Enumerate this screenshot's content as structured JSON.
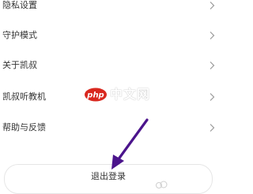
{
  "settings": {
    "items": [
      {
        "label": "隐私设置"
      },
      {
        "label": "守护模式"
      },
      {
        "label": "关于凯叔"
      },
      {
        "label": "凯叔听教机"
      },
      {
        "label": "帮助与反馈"
      }
    ]
  },
  "logout": {
    "label": "退出登录"
  },
  "watermark": {
    "text": "中文网",
    "logo": "php"
  },
  "colors": {
    "text": "#333333",
    "chevron": "#9a9a9a",
    "border": "#e6e6e6",
    "arrow": "#4b148c",
    "watermark_badge": "#d9281f"
  }
}
